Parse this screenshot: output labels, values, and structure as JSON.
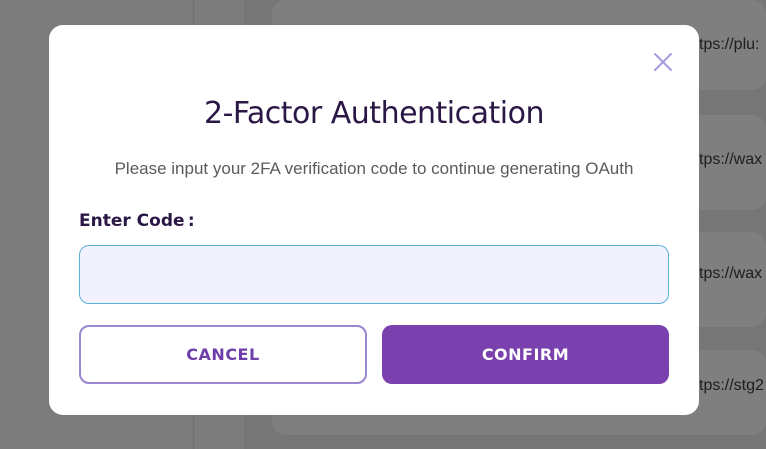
{
  "background": {
    "urls": [
      "tps://plu:",
      "tps://wax",
      "tps://wax",
      "tps://stg2"
    ]
  },
  "modal": {
    "title": "2-Factor Authentication",
    "description": "Please input your 2FA verification code to continue generating OAuth",
    "code_label": "Enter Code :",
    "code_value": "",
    "code_placeholder": "",
    "cancel_label": "CANCEL",
    "confirm_label": "CONFIRM",
    "close_icon": "close-icon"
  },
  "colors": {
    "accent": "#7a40ae",
    "title": "#2a1745",
    "input_border": "#5fb1d8",
    "input_bg": "#f2f2fe"
  }
}
